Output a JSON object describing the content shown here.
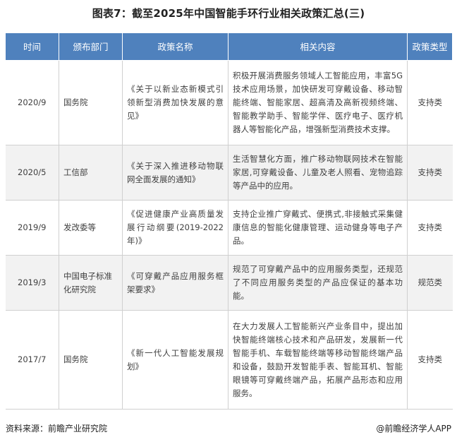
{
  "title": "图表7：截至2025年中国智能手环行业相关政策汇总(三)",
  "table": {
    "headers": [
      "时间",
      "颁布部门",
      "政策名称",
      "相关内容",
      "政策类型"
    ],
    "rows": [
      {
        "time": "2020/9",
        "dept": "国务院",
        "name": "《关于以新业态新模式引领新型消费加快发展的意见》",
        "content": "积极开展消费服务领域人工智能应用，丰富5G技术应用场景，加快研发可穿戴设备、移动智能终端、智能家居、超高清及高新视频终端、智能教学助手、智能学伴、医疗电子、医疗机器人等智能化产品，增强新型消费技术支撑。",
        "type": "支持类"
      },
      {
        "time": "2020/5",
        "dept": "工信部",
        "name": "《关于深入推进移动物联网全面发展的通知》",
        "content": "生活智慧化方面，推广移动物联网技术在智能家居,可穿戴设备、儿童及老人照看、宠物追踪等产品中的应用。",
        "type": "支持类"
      },
      {
        "time": "2019/9",
        "dept": "发改委等",
        "name": "《促进健康产业高质量发展行动纲要(2019-2022年)》",
        "content": "支持企业推广穿戴式、便携式,非接触式采集健康信息的智能化健康管理、运动健身等电子产品。",
        "type": "支持类"
      },
      {
        "time": "2019/3",
        "dept": "中国电子标准化研究院",
        "name": "《可穿戴产品应用服务框架要求》",
        "content": "规范了可穿戴产品中的应用服务类型，还规范了不同应用服务类型的产品应保证的基本功能。",
        "type": "规范类"
      },
      {
        "time": "2017/7",
        "dept": "国务院",
        "name": "《新一代人工智能发展规划》",
        "content": "在大力发展人工智能新兴产业条目中，提出加快智能终端核心技术和产品研发，发展新一代智能手机、车载智能终端等移动智能终端产品和设备，鼓励开发智能手表、智能耳机、智能眼镜等可穿戴终端产品，拓展产品形态和应用服务。",
        "type": "支持类"
      }
    ]
  },
  "footer": {
    "source": "资料来源：前瞻产业研究院",
    "brand": "@前瞻经济学人APP"
  },
  "colors": {
    "header_bg": "#4f81bd",
    "row_shade": "#f2f2f2"
  }
}
